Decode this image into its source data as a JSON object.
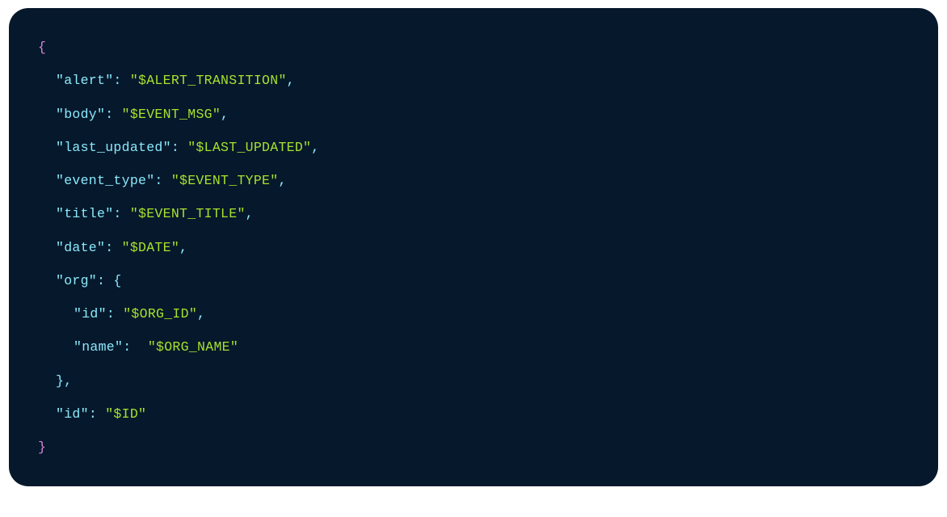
{
  "code": {
    "braces": {
      "open": "{",
      "close": "}"
    },
    "entries": [
      {
        "key": "\"alert\"",
        "colon": ":",
        "space": " ",
        "value": "\"$ALERT_TRANSITION\"",
        "comma": ","
      },
      {
        "key": "\"body\"",
        "colon": ":",
        "space": " ",
        "value": "\"$EVENT_MSG\"",
        "comma": ","
      },
      {
        "key": "\"last_updated\"",
        "colon": ":",
        "space": " ",
        "value": "\"$LAST_UPDATED\"",
        "comma": ","
      },
      {
        "key": "\"event_type\"",
        "colon": ":",
        "space": " ",
        "value": "\"$EVENT_TYPE\"",
        "comma": ","
      },
      {
        "key": "\"title\"",
        "colon": ":",
        "space": " ",
        "value": "\"$EVENT_TITLE\"",
        "comma": ","
      },
      {
        "key": "\"date\"",
        "colon": ":",
        "space": " ",
        "value": "\"$DATE\"",
        "comma": ","
      }
    ],
    "org_key": "\"org\"",
    "org_colon": ":",
    "org_open": "{",
    "org_entries": [
      {
        "key": "\"id\"",
        "colon": ":",
        "space": " ",
        "value": "\"$ORG_ID\"",
        "comma": ","
      },
      {
        "key": "\"name\"",
        "colon": ":",
        "space": "  ",
        "value": "\"$ORG_NAME\"",
        "comma": ""
      }
    ],
    "org_close": "}",
    "org_close_comma": ",",
    "last_entry": {
      "key": "\"id\"",
      "colon": ":",
      "space": " ",
      "value": "\"$ID\"",
      "comma": ""
    }
  }
}
